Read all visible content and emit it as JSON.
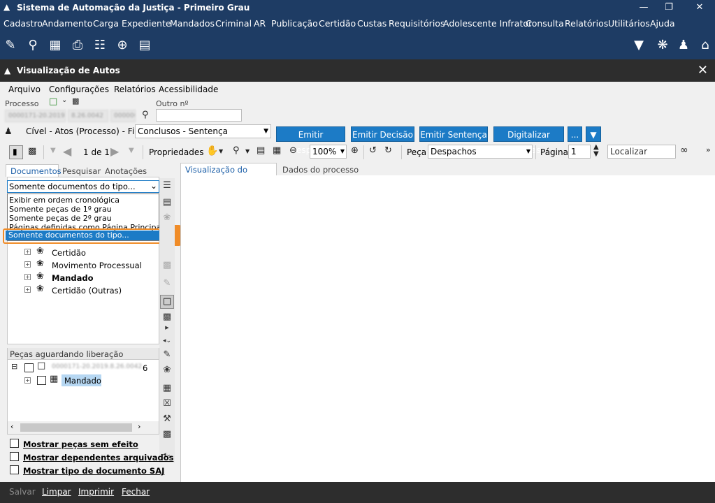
{
  "app": {
    "title": "Sistema de Automação da Justiça - Primeiro Grau"
  },
  "menu": [
    "Cadastro",
    "Andamento",
    "Carga",
    "Expediente",
    "Mandados",
    "Criminal",
    "AR",
    "Publicação",
    "Certidão",
    "Custas",
    "Requisitórios",
    "Adolescente Infrator",
    "Consulta",
    "Relatórios",
    "Utilitários",
    "Ajuda"
  ],
  "window": {
    "title": "Visualização de Autos"
  },
  "submenu": [
    "Arquivo",
    "Configurações",
    "Relatórios",
    "Acessibilidade"
  ],
  "processo": {
    "label": "Processo",
    "outro_label": "Outro nº",
    "blur1": "0000171-20.2019",
    "blur2": "8.26.0042",
    "blur3": "000000"
  },
  "fila": {
    "label": "Cível - Atos (Processo) - Fila:",
    "value": "Conclusos - Sentença"
  },
  "actions": [
    "Emitir Despacho",
    "Emitir Decisão",
    "Emitir Sentença",
    "Digitalizar Peças",
    "..."
  ],
  "toolbar": {
    "page_of": "1 de 1",
    "propriedades": "Propriedades",
    "zoom": "100%",
    "peca_label": "Peça",
    "peca_value": "Despachos",
    "pagina_label": "Página",
    "pagina_value": "1",
    "localizar_placeholder": "Localizar"
  },
  "left_tabs": [
    "Documentos",
    "Pesquisar",
    "Anotações"
  ],
  "right_tabs": [
    "Visualização do Processo",
    "Dados do processo"
  ],
  "filter": {
    "selected": "Somente documentos do tipo...",
    "options": [
      "Exibir em ordem cronológica",
      "Somente peças de 1º grau",
      "Somente peças de 2º grau",
      "Páginas definidas como Página Principal",
      "Somente documentos do tipo..."
    ]
  },
  "badge": "1",
  "tree": [
    "Certidão",
    "Movimento Processual",
    "Mandado",
    "Certidão (Outras)"
  ],
  "pecas": {
    "title": "Peças aguardando liberação",
    "root": "0000171-20.2019.8.26.0042",
    "root_suffix": "6",
    "child": "Mandado"
  },
  "checkboxes": [
    "Mostrar peças sem efeito",
    "Mostrar dependentes arquivados",
    "Mostrar tipo de documento SAJ"
  ],
  "status": [
    "Salvar",
    "Limpar",
    "Imprimir",
    "Fechar"
  ]
}
